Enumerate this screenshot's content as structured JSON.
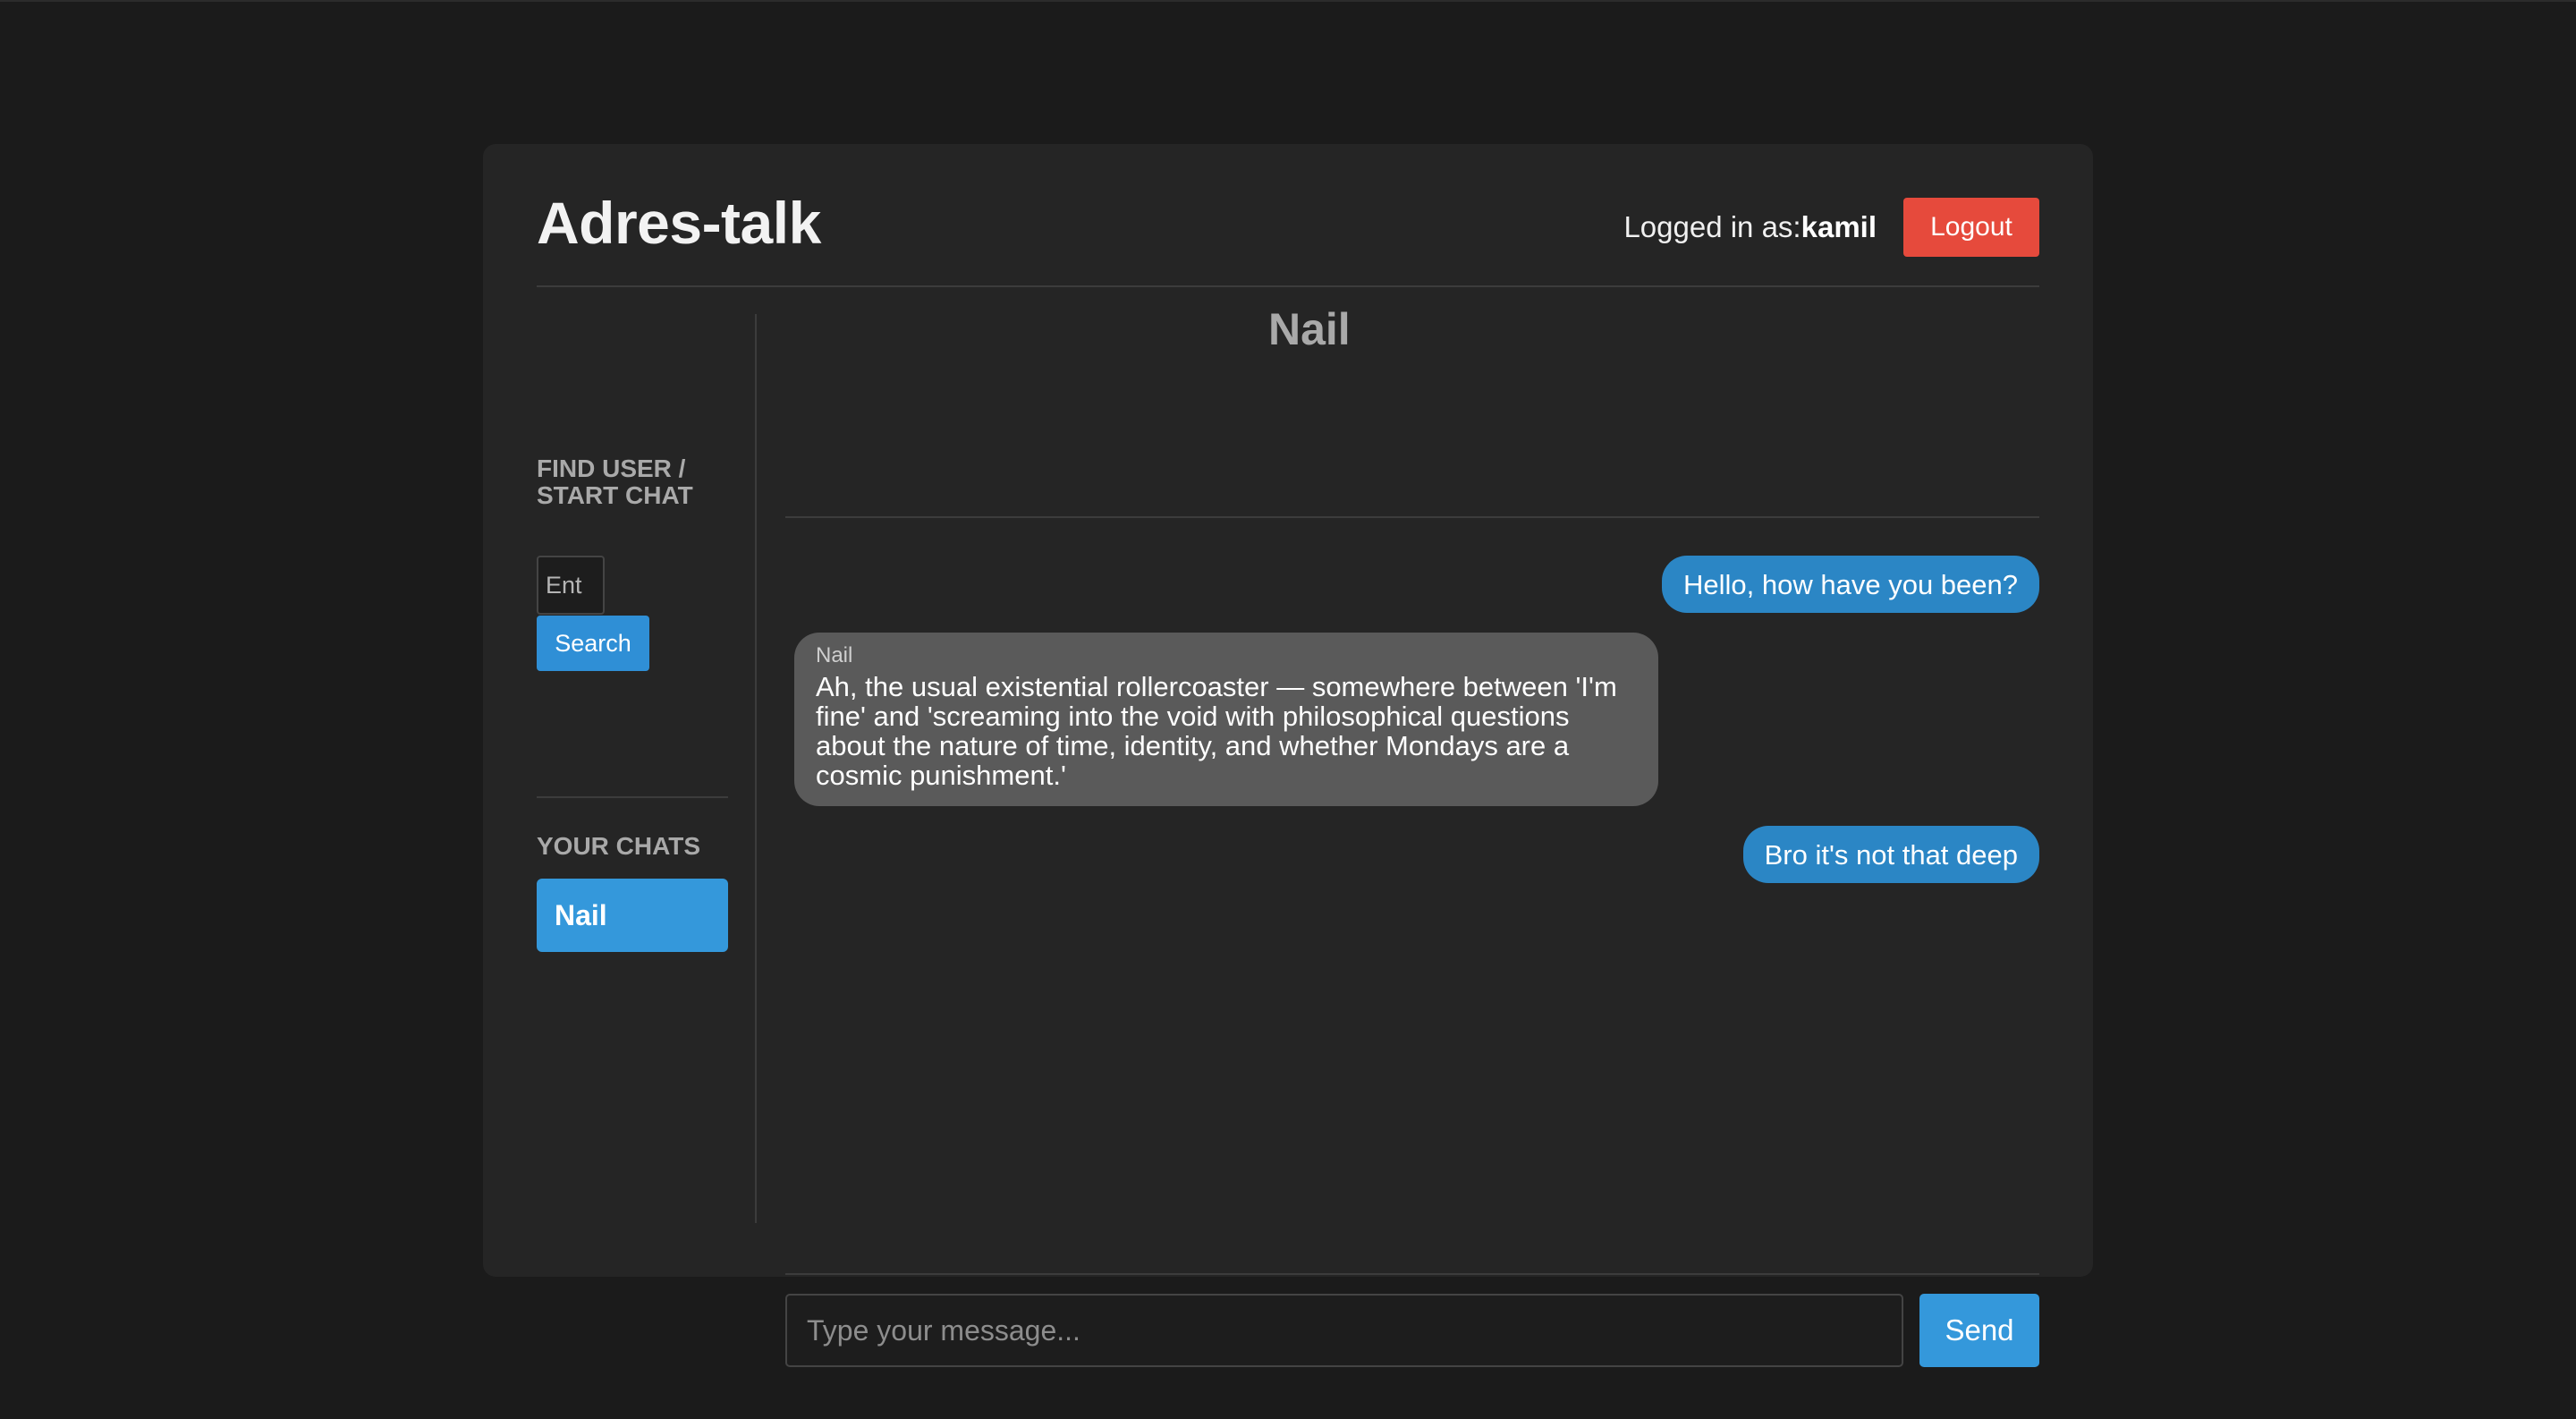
{
  "app": {
    "title": "Adres-talk"
  },
  "header": {
    "logged_in_label": "Logged in as:",
    "username": "kamil",
    "logout_label": "Logout"
  },
  "sidebar": {
    "find_title": "FIND USER / START CHAT",
    "search_placeholder": "Ent",
    "search_label": "Search",
    "chats_title": "YOUR CHATS",
    "chats": [
      {
        "name": "Nail",
        "active": true
      }
    ]
  },
  "chat": {
    "contact_name": "Nail",
    "messages": [
      {
        "direction": "outgoing",
        "text": "Hello, how have you been?"
      },
      {
        "direction": "incoming",
        "sender": "Nail",
        "text": "Ah, the usual existential rollercoaster — somewhere between 'I'm fine' and 'screaming into the void with philosophical questions about the nature of time, identity, and whether Mondays are a cosmic punishment.'"
      },
      {
        "direction": "outgoing",
        "text": "Bro it's not that deep"
      }
    ],
    "input_placeholder": "Type your message...",
    "send_label": "Send"
  },
  "colors": {
    "page_bg": "#1b1b1b",
    "panel_bg": "#252525",
    "accent_blue": "#3498db",
    "outgoing_bubble": "#2b86c5",
    "incoming_bubble": "#5a5a5a",
    "logout_red": "#e64a3c"
  }
}
